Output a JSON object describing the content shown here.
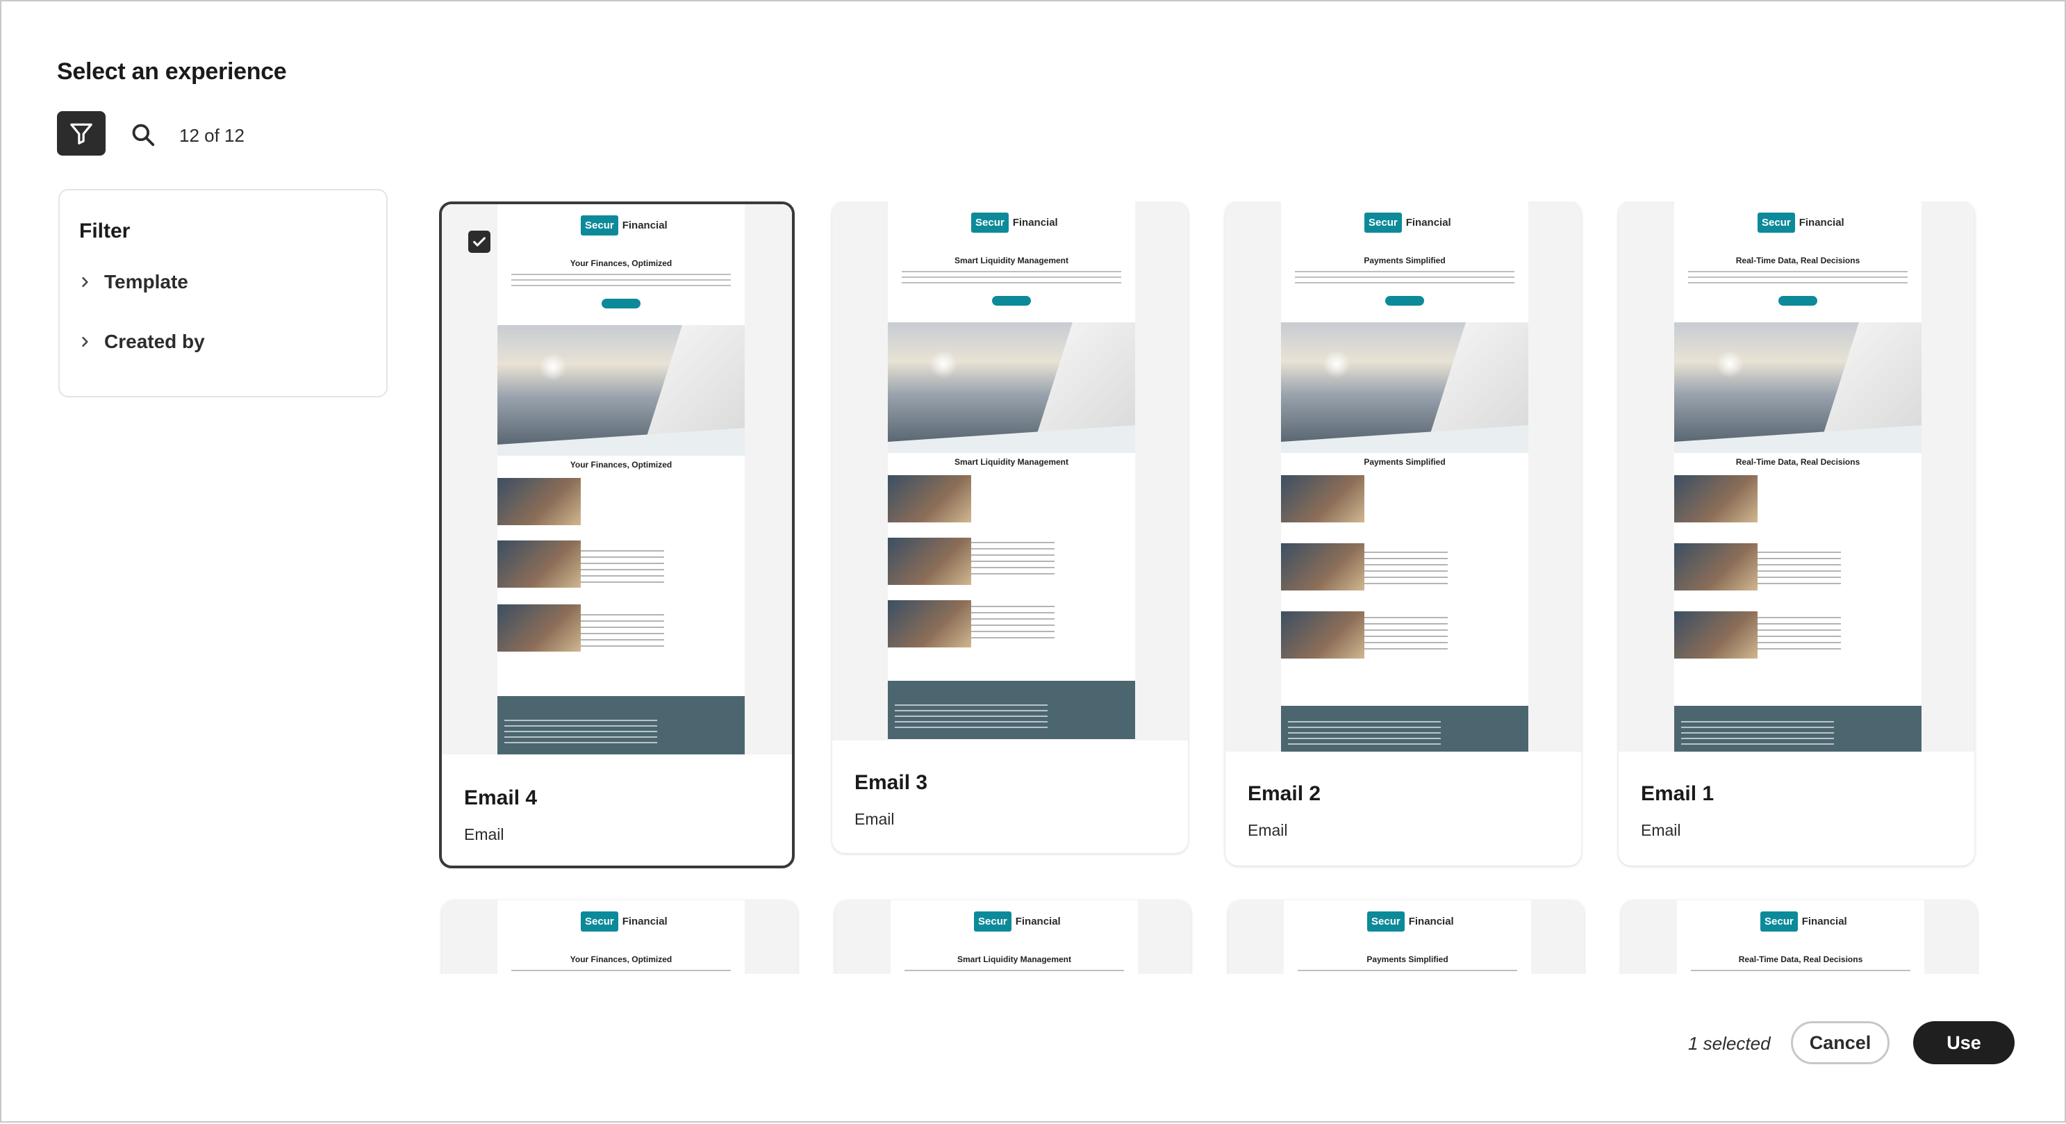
{
  "dialog": {
    "title": "Select an experience",
    "count_label": "12 of 12"
  },
  "toolbar": {
    "filter_icon": "filter-icon",
    "search_icon": "search-icon"
  },
  "filter": {
    "title": "Filter",
    "items": [
      {
        "label": "Template",
        "icon": "chevron-right-icon"
      },
      {
        "label": "Created by",
        "icon": "chevron-right-icon"
      }
    ]
  },
  "preview_email": {
    "brand_box": "Secur",
    "brand_text": "Financial"
  },
  "cards": [
    {
      "name": "Email 4",
      "type": "Email",
      "selected": true,
      "headline": "Your Finances, Optimized"
    },
    {
      "name": "Email 3",
      "type": "Email",
      "selected": false,
      "headline": "Smart Liquidity Management"
    },
    {
      "name": "Email 2",
      "type": "Email",
      "selected": false,
      "headline": "Payments Simplified"
    },
    {
      "name": "Email 1",
      "type": "Email",
      "selected": false,
      "headline": "Real-Time Data, Real Decisions"
    },
    {
      "headline": "Your Finances, Optimized"
    },
    {
      "headline": "Smart Liquidity Management"
    },
    {
      "headline": "Payments Simplified"
    },
    {
      "headline": "Real-Time Data, Real Decisions"
    }
  ],
  "footer": {
    "selected_count": "1 selected",
    "cancel_label": "Cancel",
    "use_label": "Use"
  },
  "colors": {
    "brand": "#0d8a9a",
    "primary_button": "#1f1f1f",
    "footer_band": "#4c6670"
  }
}
